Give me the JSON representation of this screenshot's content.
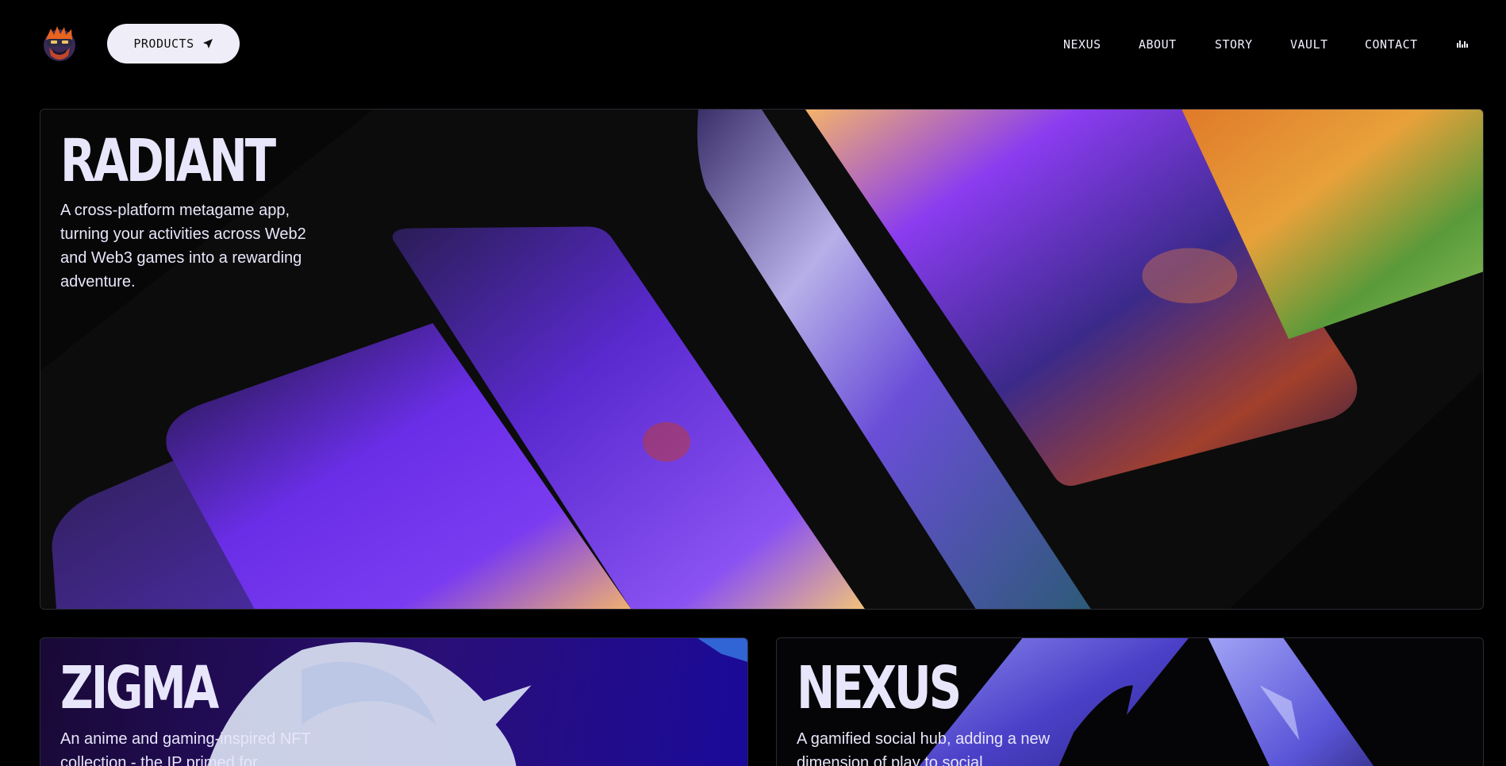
{
  "nav": {
    "logo_alt": "logo",
    "products_label": "PRODUCTS",
    "links": [
      "NEXUS",
      "ABOUT",
      "STORY",
      "VAULT",
      "CONTACT"
    ]
  },
  "cards": {
    "radiant": {
      "title": "RADIANT",
      "description": "A cross-platform metagame app, turning your activities across Web2 and Web3 games into a rewarding adventure."
    },
    "zigma": {
      "title": "ZIGMA",
      "description": "An anime and gaming-inspired NFT collection - the IP primed for"
    },
    "nexus": {
      "title": "NEXUS",
      "description": "A gamified social hub, adding a new dimension of play to social"
    }
  },
  "colors": {
    "background": "#000000",
    "text": "#e8e6fa",
    "button_bg": "#efeef8",
    "accent_purple": "#6b2cf5"
  }
}
